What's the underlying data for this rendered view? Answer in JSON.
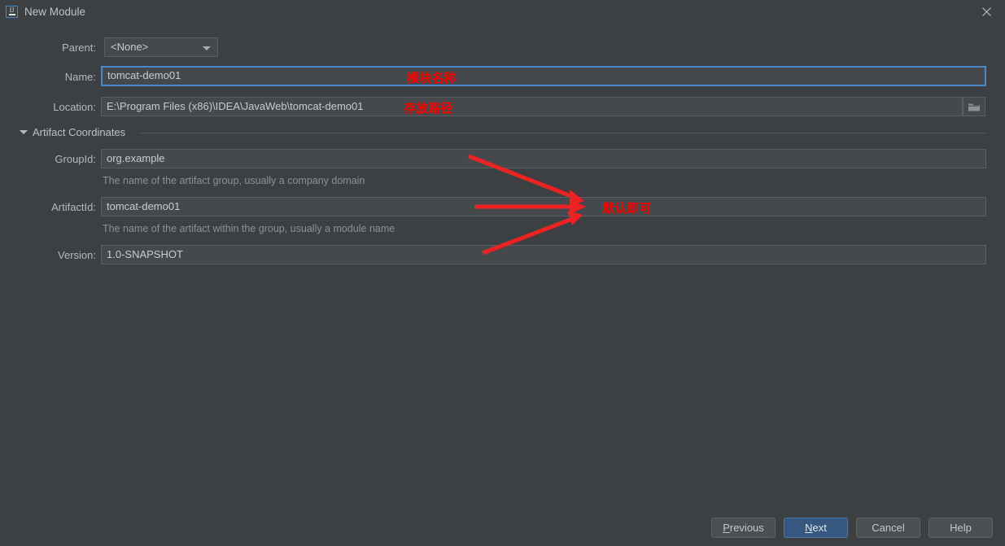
{
  "window": {
    "title": "New Module",
    "app_icon": "intellij-idea-icon",
    "icon_text": "IJ",
    "close_icon": "close-icon"
  },
  "form": {
    "parent": {
      "label": "Parent:",
      "value": "<None>",
      "arrow_icon": "chevron-down-icon"
    },
    "name": {
      "label": "Name:",
      "value": "tomcat-demo01",
      "focused": true
    },
    "location": {
      "label": "Location:",
      "value": "E:\\Program Files (x86)\\IDEA\\JavaWeb\\tomcat-demo01",
      "browse_icon": "folder-icon"
    },
    "artifact_coordinates": {
      "section_label": "Artifact Coordinates",
      "toggle_icon": "triangle-down-icon",
      "expanded": true,
      "group_id": {
        "label": "GroupId:",
        "value": "org.example",
        "helper": "The name of the artifact group, usually a company domain"
      },
      "artifact_id": {
        "label": "ArtifactId:",
        "value": "tomcat-demo01",
        "helper": "The name of the artifact within the group, usually a module name"
      },
      "version": {
        "label": "Version:",
        "value": "1.0-SNAPSHOT"
      }
    }
  },
  "buttons": {
    "previous": "Previous",
    "previous_mnemonic": "P",
    "next": "Next",
    "next_mnemonic": "N",
    "cancel": "Cancel",
    "help": "Help"
  },
  "annotations": {
    "color": "#ff0000",
    "name_note": "模块名称",
    "location_note": "存放路径",
    "defaults_note": "默认即可"
  }
}
